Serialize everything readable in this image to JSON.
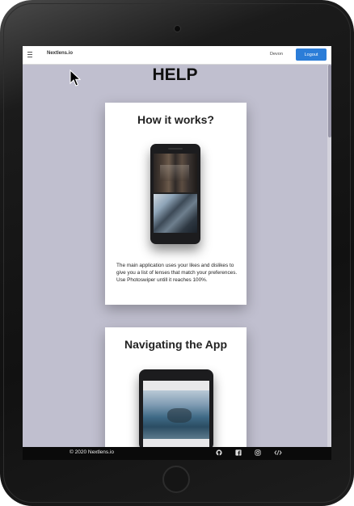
{
  "navbar": {
    "brand": "Nextlens.io",
    "username": "Devon",
    "logout_label": "Logout"
  },
  "page": {
    "title": "HELP"
  },
  "cards": [
    {
      "title": "How it works?",
      "description": "The main application uses your likes and dislikes to give you a list of lenses that match your preferences. Use Photoswiper untill it reaches 100%."
    },
    {
      "title": "Navigating the App"
    }
  ],
  "footer": {
    "copyright": "2020 Nextlens.io",
    "icons": [
      "github-icon",
      "facebook-icon",
      "instagram-icon",
      "code-icon"
    ]
  }
}
